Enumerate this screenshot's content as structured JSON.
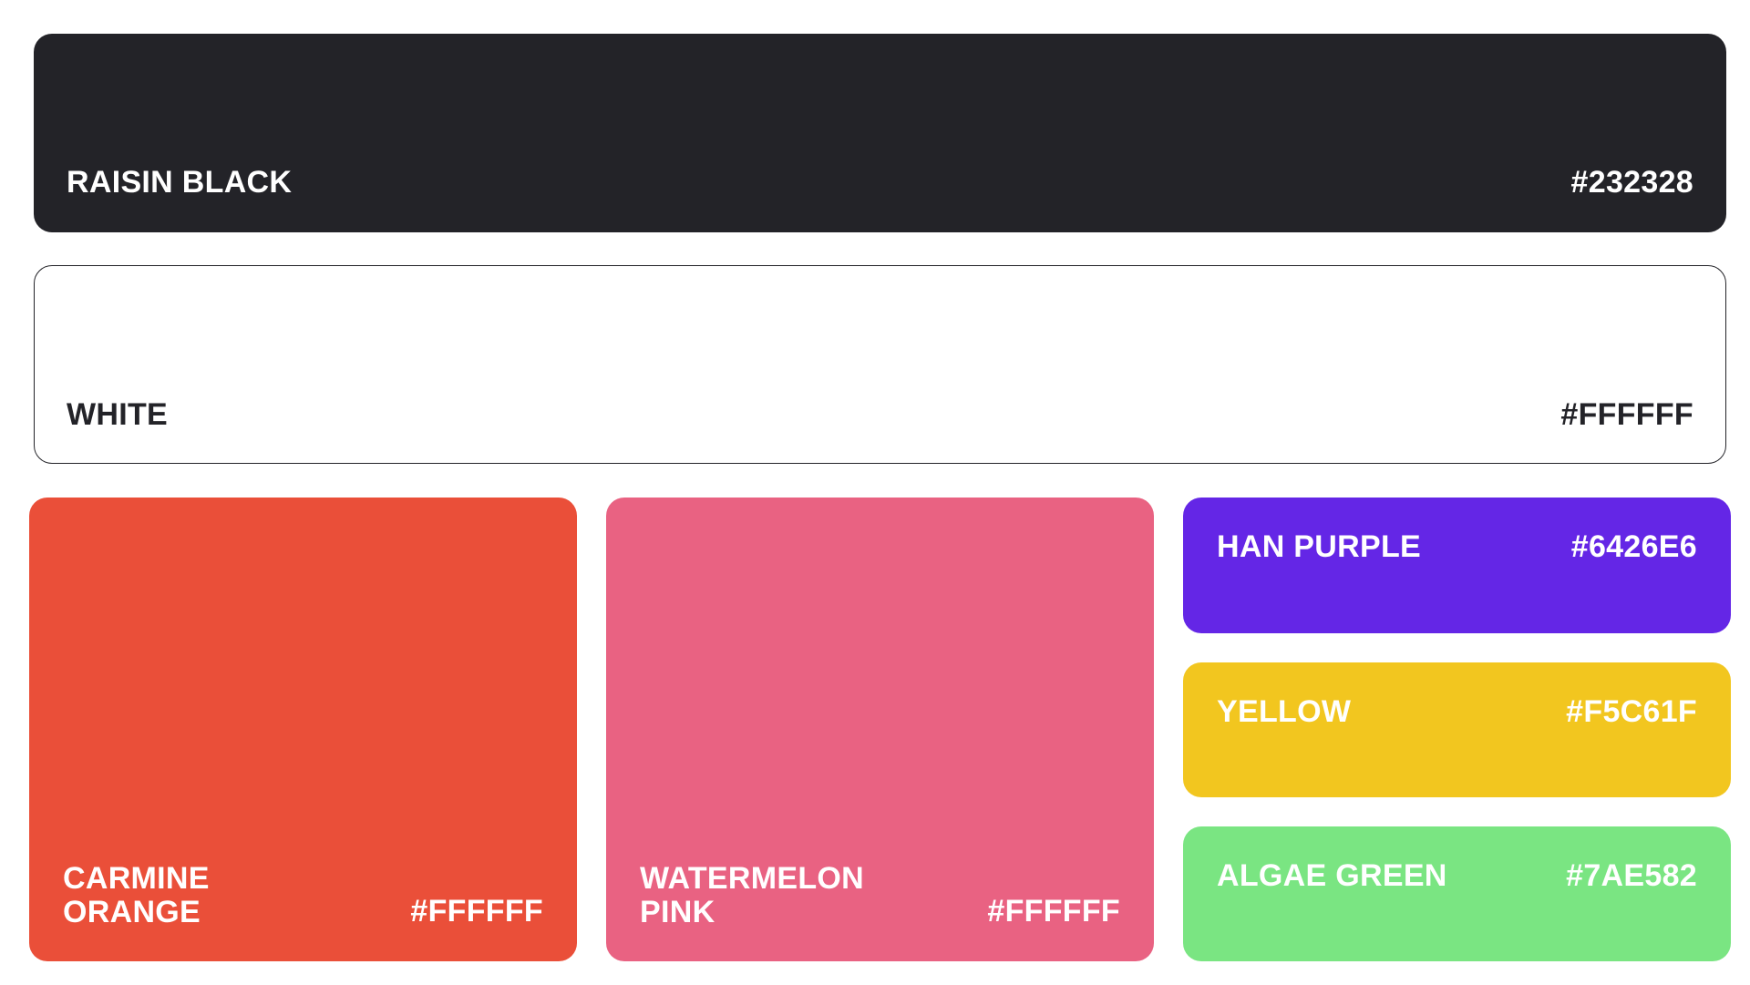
{
  "swatches": {
    "raisin_black": {
      "name": "RAISIN BLACK",
      "hex": "#232328",
      "bg": "#232328",
      "text_color": "#FFFFFF"
    },
    "white": {
      "name": "WHITE",
      "hex": "#FFFFFF",
      "bg": "#FFFFFF",
      "text_color": "#232328"
    },
    "carmine_orange": {
      "name": "CARMINE\nORANGE",
      "hex": "#FFFFFF",
      "bg": "#EA4F39",
      "text_color": "#FFFFFF"
    },
    "watermelon_pink": {
      "name": "WATERMELON\nPINK",
      "hex": "#FFFFFF",
      "bg": "#E96282",
      "text_color": "#FFFFFF"
    },
    "han_purple": {
      "name": "HAN PURPLE",
      "hex": "#6426E6",
      "bg": "#6426E6",
      "text_color": "#FFFFFF"
    },
    "yellow": {
      "name": "YELLOW",
      "hex": "#F5C61F",
      "bg": "#F2C61F",
      "text_color": "#FFFFFF"
    },
    "algae_green": {
      "name": "ALGAE GREEN",
      "hex": "#7AE582",
      "bg": "#7AE582",
      "text_color": "#FFFFFF"
    }
  }
}
